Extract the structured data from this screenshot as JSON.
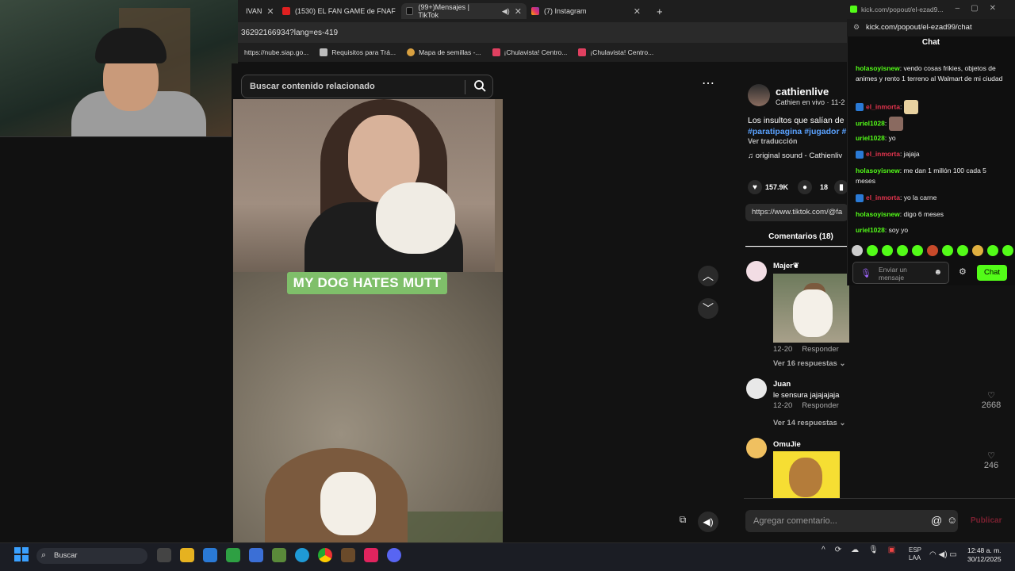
{
  "browser": {
    "tabs": [
      {
        "label": "IVAN",
        "active": false
      },
      {
        "label": "(1530) EL FAN GAME de FNAF",
        "active": false
      },
      {
        "label": "(99+)Mensajes | TikTok",
        "active": true
      },
      {
        "label": "(7) Instagram",
        "active": false
      }
    ],
    "new_tab": "+",
    "address": "36292166934?lang=es-419",
    "bookmarks": [
      {
        "label": "https://nube.siap.go..."
      },
      {
        "label": "Requisitos para Trá..."
      },
      {
        "label": "Mapa de semillas -..."
      },
      {
        "label": "¡Chulavista! Centro..."
      },
      {
        "label": "¡Chulavista! Centro..."
      }
    ]
  },
  "tiktok": {
    "search_placeholder": "Buscar contenido relacionado",
    "video_caption": "MY DOG HATES MUTT",
    "more_icon": "⋯",
    "author": {
      "name": "cathienlive",
      "subtitle": "Cathien en vivo · 11-2"
    },
    "description": "Los insultos que salían de",
    "hashtags": "#paratipagina #jugador #",
    "translate": "Ver traducción",
    "sound": "♫  original sound - Cathienliv",
    "stats": {
      "likes": "157.9K",
      "comments": "18"
    },
    "link": "https://www.tiktok.com/@fa",
    "comments_tab": "Comentarios (18)",
    "comments": [
      {
        "user": "Majer❦",
        "text": "",
        "date": "12-20",
        "reply": "Responder",
        "replies": "Ver 16 respuestas",
        "likes": ""
      },
      {
        "user": "Juan",
        "text": "le sensura jajajajaja",
        "date": "12-20",
        "reply": "Responder",
        "replies": "Ver 14 respuestas",
        "likes": "2668"
      },
      {
        "user": "OmuJie",
        "text": "",
        "date": "",
        "reply": "",
        "replies": "",
        "likes": "246"
      }
    ],
    "add_comment_placeholder": "Agregar comentario...",
    "publish": "Publicar"
  },
  "kick": {
    "title_bar": "kick.com/popout/el-ezad9...",
    "url": "kick.com/popout/el-ezad99/chat",
    "header": "Chat",
    "messages": [
      {
        "user": "holasoyisnew",
        "text": ": vendo cosas frikies, objetos de animes y rento 1 terreno al Walmart de mi ciudad",
        "color": "g"
      },
      {
        "user": "el_inmorta",
        "text": ":",
        "color": "r",
        "badge": true
      },
      {
        "user": "uriel1028",
        "text": ":",
        "color": "g"
      },
      {
        "user": "uriel1028",
        "text": ": yo",
        "color": "g"
      },
      {
        "user": "el_inmorta",
        "text": ": jajaja",
        "color": "r",
        "badge": true
      },
      {
        "user": "holasoyisnew",
        "text": ": me dan 1 millón 100 cada 5 meses",
        "color": "g"
      },
      {
        "user": "el_inmorta",
        "text": ": yo la carne",
        "color": "r",
        "badge": true
      },
      {
        "user": "holasoyisnew",
        "text": ": digo 6 meses",
        "color": "g"
      },
      {
        "user": "uriel1028",
        "text": ": soy yo",
        "color": "g"
      }
    ],
    "input_placeholder": "Enviar un mensaje",
    "send_label": "Chat"
  },
  "taskbar": {
    "search_placeholder": "Buscar",
    "lang": "ESP",
    "lang_sub": "LAA",
    "time": "12:48 a. m.",
    "date": "30/12/2025"
  },
  "colors": {
    "kick_green": "#53fc18",
    "tiktok_link": "#5aa2ff",
    "caption_bg": "#7fbf6a"
  }
}
